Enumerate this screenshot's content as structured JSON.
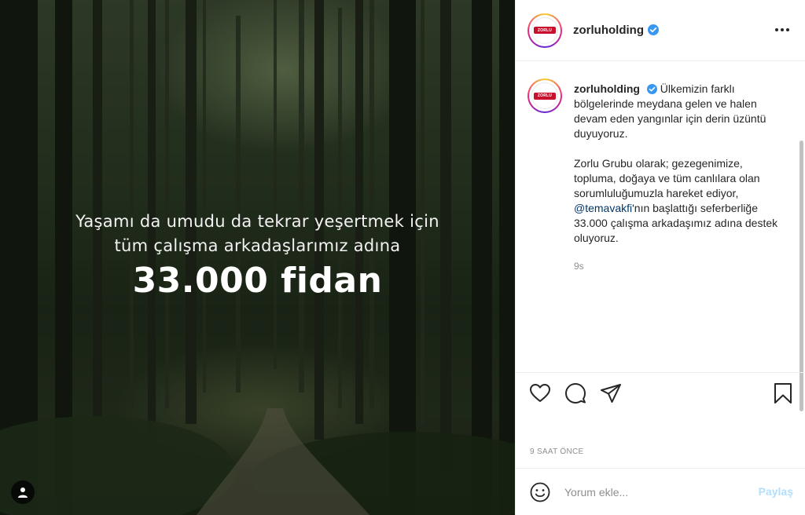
{
  "media": {
    "overlay_line1": "Yaşamı da umudu da tekrar yeşertmek için",
    "overlay_line2": "tüm çalışma arkadaşlarımız adına",
    "overlay_headline": "33.000 fidan"
  },
  "account": {
    "username": "zorluholding",
    "logo_text": "ZORLU",
    "verified": true
  },
  "caption": {
    "username": "zorluholding",
    "text_part1": "Ülkemizin farklı bölgelerinde meydana gelen ve halen devam eden yangınlar için derin üzüntü duyuyoruz.",
    "text_part2_before": "Zorlu Grubu olarak; gezegenimize, topluma, doğaya ve tüm canlılara olan sorumluluğumuzla hareket ediyor, ",
    "mention": "@temavakfi",
    "text_part2_after": "'nın başlattığı seferberliğe 33.000 çalışma arkadaşımız adına destek oluyoruz.",
    "time": "9s"
  },
  "post_date": "9 SAAT ÖNCE",
  "comment": {
    "placeholder": "Yorum ekle...",
    "post_label": "Paylaş"
  },
  "icons": {
    "like": "heart-icon",
    "comment": "comment-icon",
    "share": "paper-plane-icon",
    "save": "bookmark-icon",
    "more": "more-horizontal-icon",
    "emoji": "emoji-icon",
    "user_tag": "user-icon",
    "verified": "verified-badge-icon"
  },
  "colors": {
    "verified_blue": "#3897f0",
    "mention": "#00376b",
    "post_button_disabled": "#b2dffc",
    "brand_red": "#c8102e"
  }
}
